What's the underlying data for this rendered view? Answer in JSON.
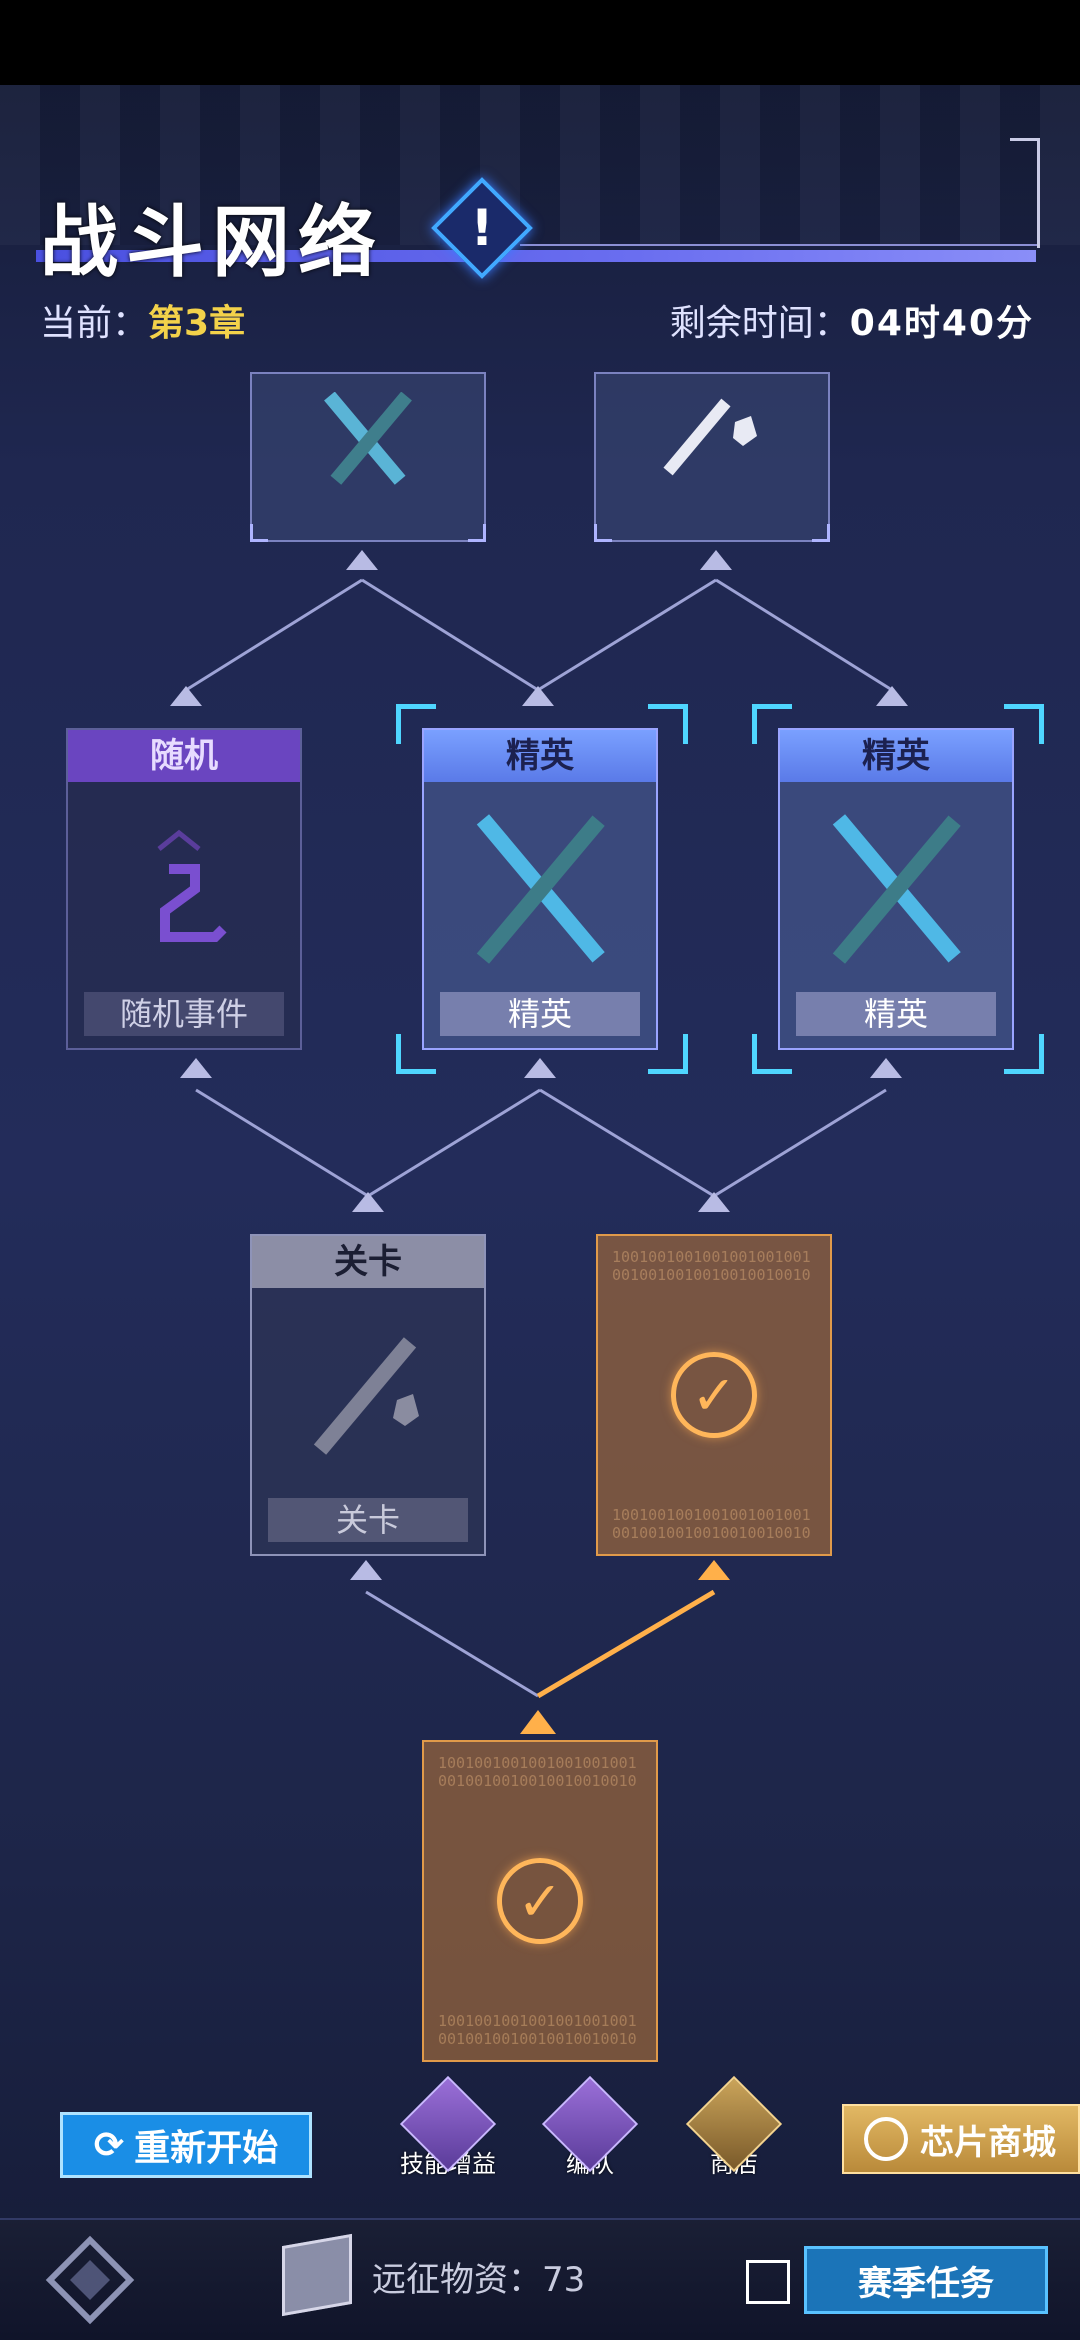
{
  "header": {
    "title": "战斗网络",
    "chapter_label": "当前：",
    "chapter_value": "第3章",
    "remain_label": "剩余时间：",
    "remain_value": "04时40分"
  },
  "nodes": {
    "top_left": {
      "type": "battle"
    },
    "top_right": {
      "type": "stage"
    },
    "random": {
      "head": "随机",
      "foot": "随机事件"
    },
    "elite_1": {
      "head": "精英",
      "foot": "精英"
    },
    "elite_2": {
      "head": "精英",
      "foot": "精英"
    },
    "stage": {
      "head": "关卡",
      "foot": "关卡"
    },
    "done_upper": {
      "status": "completed"
    },
    "done_lower": {
      "status": "completed"
    }
  },
  "actions": {
    "restart": "重新开始",
    "skill_boost": "技能增益",
    "formation": "编队",
    "shop": "商店",
    "chip_shop": "芯片商城"
  },
  "bottom": {
    "supply_label": "远征物资：",
    "supply_value": "73",
    "season_task": "赛季任务"
  },
  "colors": {
    "accent_blue": "#4fd6ff",
    "elite_head": "#7aa0ff",
    "random_head": "#6a45c0",
    "completed": "#ffb65a"
  }
}
